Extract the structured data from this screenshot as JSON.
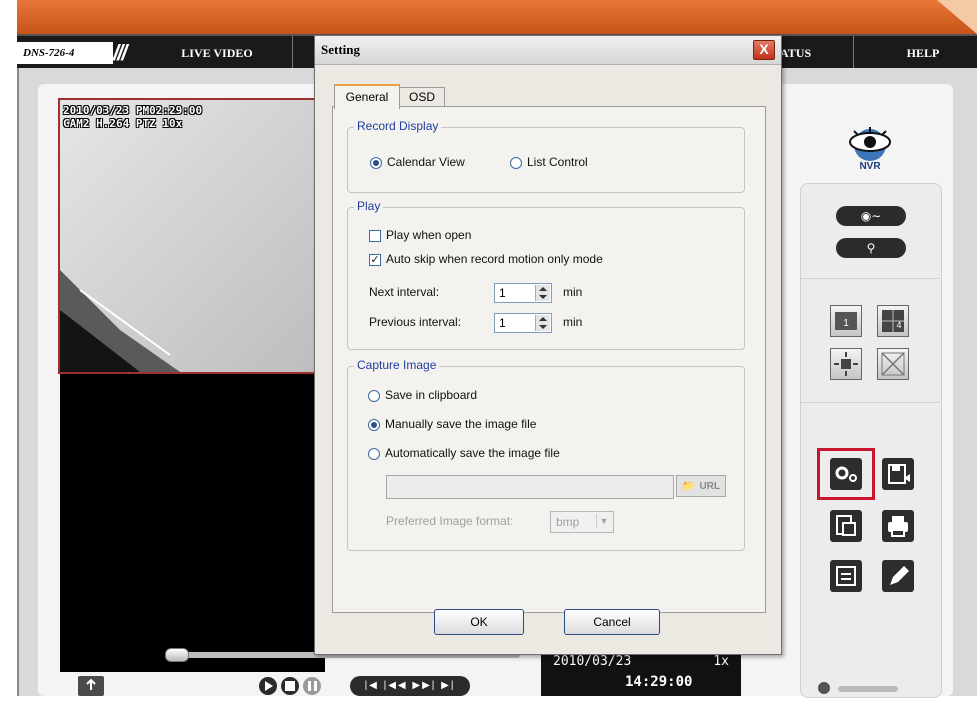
{
  "nav": {
    "model": "DNS-726-4",
    "items": [
      "LIVE VIDEO",
      "ATUS",
      "HELP"
    ]
  },
  "video": {
    "overlay_line1": "2010/03/23 PM02:29:00",
    "overlay_line2": "CAM2 H.264 PTZ 10x"
  },
  "logo": {
    "text": "NVR"
  },
  "sidebar": {
    "icons": [
      "film-reel-icon",
      "search-icon",
      "single-view-icon",
      "quad-view-icon",
      "zoom-fit-icon",
      "fullscreen-icon",
      "settings-icon",
      "save-icon",
      "snapshot-icon",
      "print-icon",
      "backup-icon",
      "edit-icon"
    ]
  },
  "bottom": {
    "date": "2010/03/23",
    "speed": "1x",
    "time": "14:29:00"
  },
  "dialog": {
    "title": "Setting",
    "close": "X",
    "tabs": [
      "General",
      "OSD"
    ],
    "record_display": {
      "title": "Record Display",
      "options": [
        "Calendar View",
        "List Control"
      ],
      "selected": "Calendar View"
    },
    "play": {
      "title": "Play",
      "play_when_open": {
        "label": "Play when open",
        "checked": false
      },
      "auto_skip": {
        "label": "Auto skip when record motion only mode",
        "checked": true
      },
      "next_interval": {
        "label": "Next interval:",
        "value": "1",
        "unit": "min"
      },
      "previous_interval": {
        "label": "Previous interval:",
        "value": "1",
        "unit": "min"
      }
    },
    "capture": {
      "title": "Capture Image",
      "options": [
        "Save in clipboard",
        "Manually save the image file",
        "Automatically save the image file"
      ],
      "selected": "Manually save the image file",
      "path_value": "",
      "browse_label": "URL",
      "format_label": "Preferred Image format:",
      "format_value": "bmp"
    },
    "ok": "OK",
    "cancel": "Cancel"
  }
}
